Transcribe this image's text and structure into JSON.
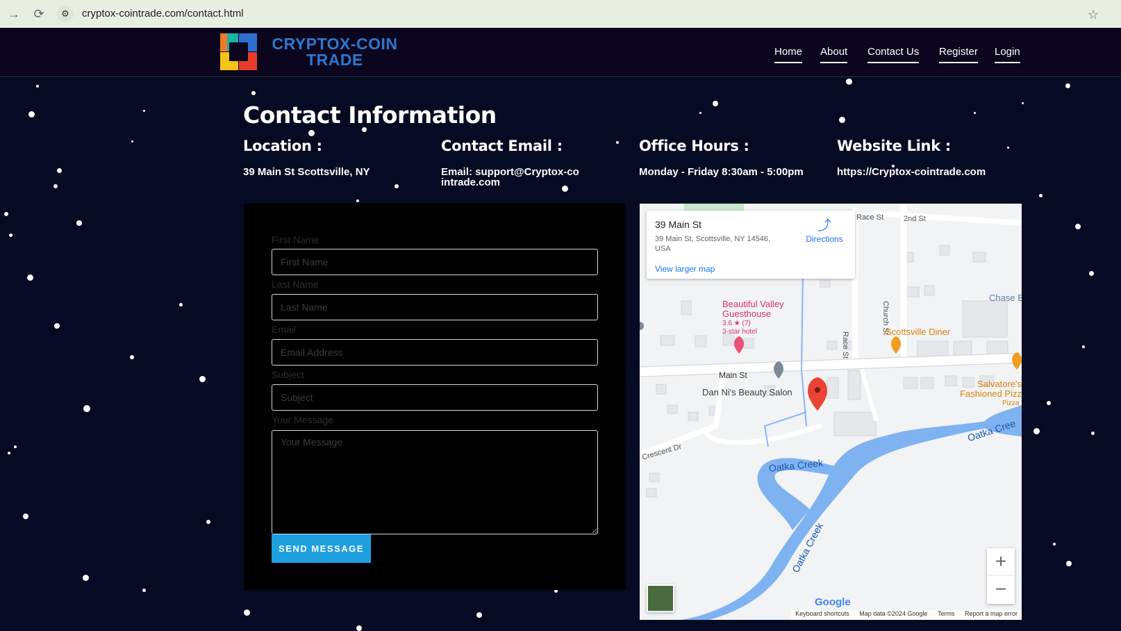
{
  "browser": {
    "url": "cryptox-cointrade.com/contact.html",
    "icons": {
      "forward": "arrow-right-icon",
      "reload": "reload-icon",
      "site": "site-settings-icon",
      "bookmark": "star-icon"
    }
  },
  "header": {
    "logo_line1": "CRYPTOX-COIN",
    "logo_line2": "TRADE",
    "nav": [
      "Home",
      "About",
      "Contact Us",
      "Register",
      "Login"
    ]
  },
  "page": {
    "title": "Contact Information",
    "info": [
      {
        "heading": "Location :",
        "value": "39 Main St Scottsville, NY"
      },
      {
        "heading": "Contact Email :",
        "value": "Email: support@Cryptox-cointrade.com"
      },
      {
        "heading": "Office Hours :",
        "value": "Monday - Friday 8:30am - 5:00pm"
      },
      {
        "heading": "Website Link :",
        "value": "https://Cryptox-cointrade.com"
      }
    ]
  },
  "form": {
    "first_name_label": "First Name",
    "first_name_placeholder": "First Name",
    "last_name_label": "Last Name",
    "last_name_placeholder": "Last Name",
    "email_label": "Email",
    "email_placeholder": "Email Address",
    "subject_label": "Subject",
    "subject_placeholder": "Subject",
    "message_label": "Your Message",
    "message_placeholder": "Your Message",
    "submit_label": "SEND MESSAGE"
  },
  "map": {
    "place_title": "39 Main St",
    "place_address": "39 Main St, Scottsville, NY 14546, USA",
    "directions_label": "Directions",
    "larger_map_label": "View larger map",
    "labels": {
      "race_st_top": "Race St",
      "second_st": "2nd St",
      "chase": "Chase E",
      "church_st": "Church St",
      "race_st": "Race St",
      "guesthouse": "Beautiful Valley Guesthouse",
      "guesthouse_rating": "3.6 ★ (7)",
      "guesthouse_type": "3-star hotel",
      "diner": "Scottsville Diner",
      "main_st": "Main St",
      "salon": "Dan Ni's Beauty Salon",
      "salvatore": "Salvatore's Fashioned Pizz",
      "pizza": "Pizza",
      "crescent": "Crescent Dr",
      "oatka_1": "Oatka Creek",
      "oatka_2": "Oatka Cree",
      "oatka_3": "Oatka Creek"
    },
    "zoom_in": "+",
    "zoom_out": "−",
    "google": "Google",
    "footer": [
      "Keyboard shortcuts",
      "Map data ©2024 Google",
      "Terms",
      "Report a map error"
    ]
  }
}
